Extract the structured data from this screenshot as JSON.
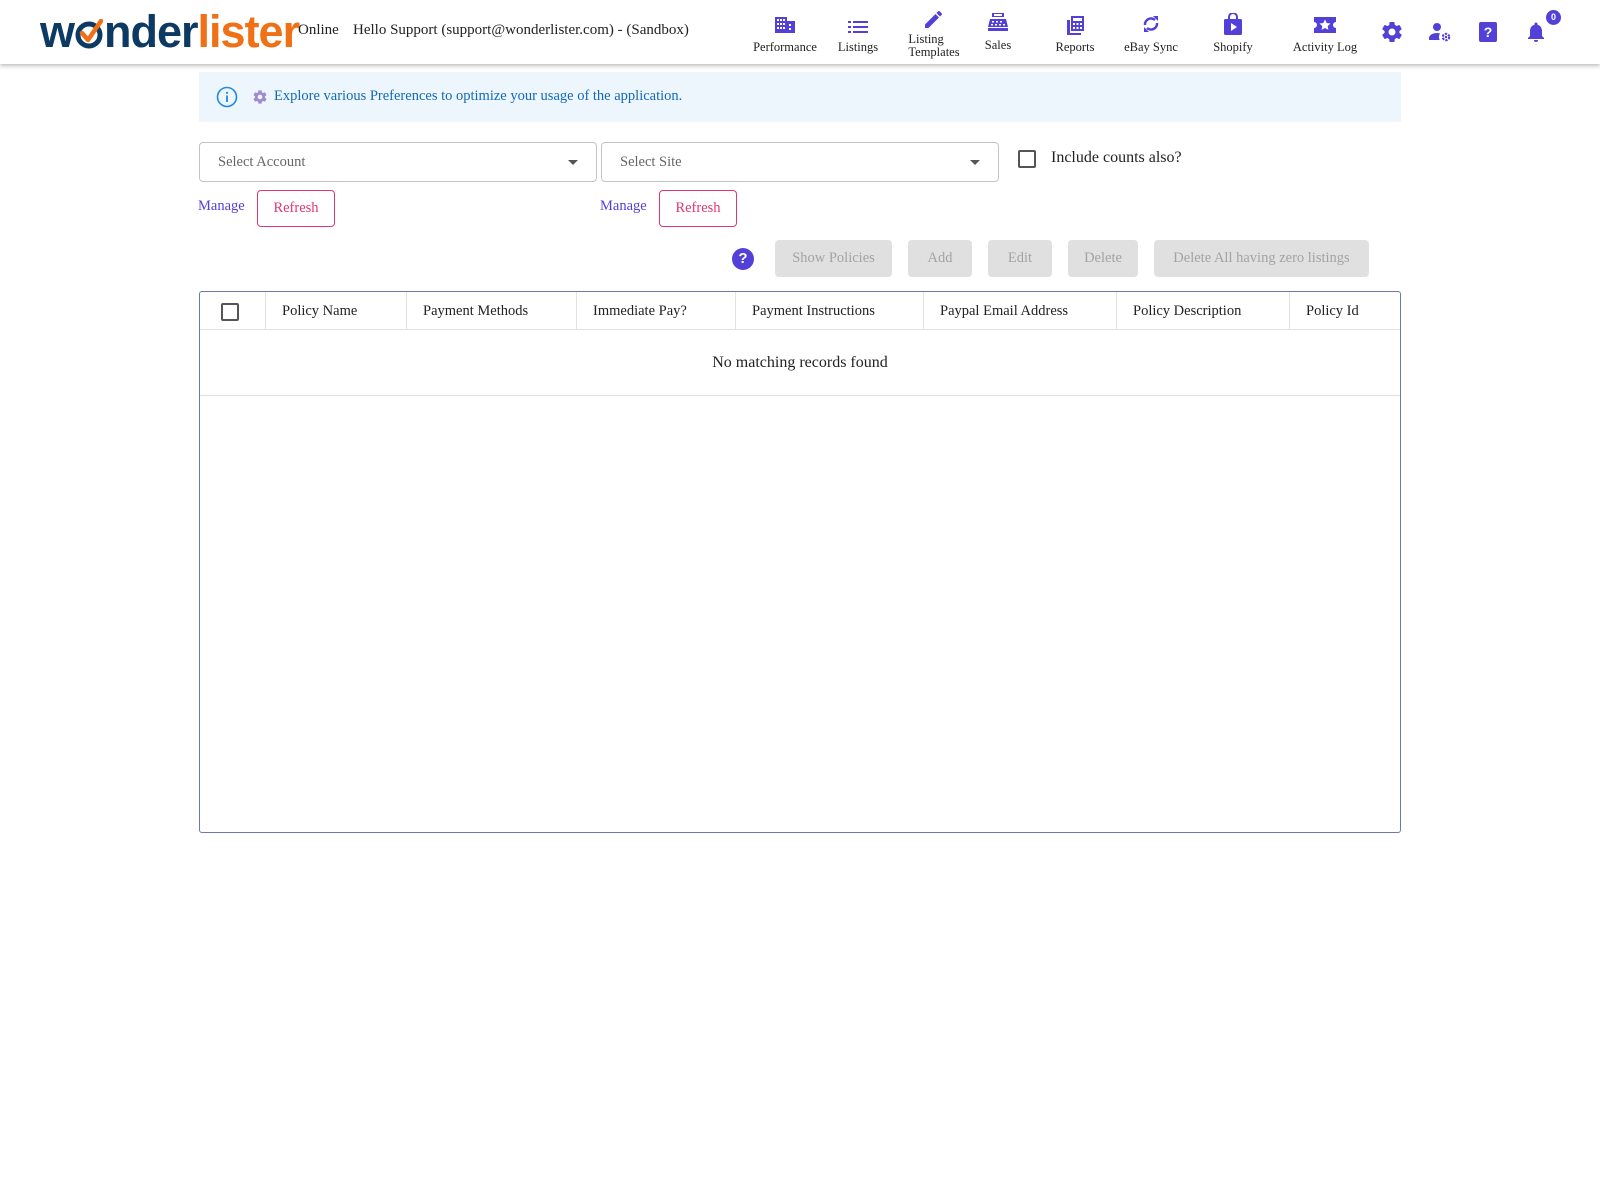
{
  "header": {
    "logo_prefix": "w",
    "logo_middle": "nder",
    "logo_suffix": "lister",
    "status": "Online",
    "greeting": "Hello Support (support@wonderlister.com) - (Sandbox)",
    "nav": [
      {
        "label": "Performance",
        "icon": "building-icon"
      },
      {
        "label": "Listings",
        "icon": "list-icon"
      },
      {
        "label_line1": "Listing",
        "label_line2": "Templates",
        "icon": "pencil-icon"
      },
      {
        "label": "Sales",
        "icon": "cash-register-icon"
      },
      {
        "label": "Reports",
        "icon": "reports-icon"
      },
      {
        "label": "eBay Sync",
        "icon": "sync-icon"
      },
      {
        "label": "Shopify",
        "icon": "shopify-bag-icon"
      },
      {
        "label": "Activity Log",
        "icon": "ticket-star-icon"
      }
    ],
    "notification_count": "0",
    "accent_color": "#5340d8"
  },
  "banner": {
    "message": "Explore various Preferences to optimize your usage of the application."
  },
  "filters": {
    "account_placeholder": "Select Account",
    "site_placeholder": "Select Site",
    "include_counts_label": "Include counts also?",
    "manage_label": "Manage",
    "refresh_label": "Refresh"
  },
  "toolbar": {
    "show_policies": "Show Policies",
    "add": "Add",
    "edit": "Edit",
    "delete": "Delete",
    "delete_zero": "Delete All having zero listings",
    "help": "?"
  },
  "table": {
    "columns": [
      "Policy Name",
      "Payment Methods",
      "Immediate Pay?",
      "Payment Instructions",
      "Paypal Email Address",
      "Policy Description",
      "Policy Id"
    ],
    "empty_message": "No matching records found"
  }
}
